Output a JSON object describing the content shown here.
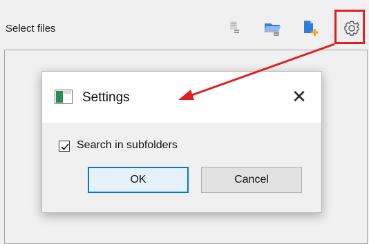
{
  "panel": {
    "title": "Select files",
    "toolbar": {
      "buttons": [
        {
          "icon": "list-file-icon"
        },
        {
          "icon": "folder-list-icon"
        },
        {
          "icon": "add-file-icon"
        },
        {
          "icon": "gear-icon"
        }
      ]
    }
  },
  "dialog": {
    "title": "Settings",
    "close_glyph": "✕",
    "checkbox": {
      "label": "Search in subfolders",
      "checked": true
    },
    "ok_label": "OK",
    "cancel_label": "Cancel"
  },
  "colors": {
    "annotation_red": "#e02020",
    "ok_border": "#0078d7",
    "icon_blue": "#2f7ed8",
    "icon_orange": "#f5a623"
  }
}
